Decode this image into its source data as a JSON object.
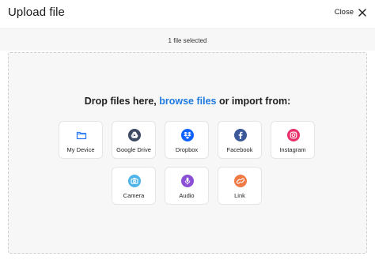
{
  "header": {
    "title": "Upload file",
    "close_label": "Close"
  },
  "subbar": {
    "status": "1 file selected"
  },
  "dropzone": {
    "prompt_start": "Drop files here, ",
    "prompt_link": "browse files",
    "prompt_end": " or import from:"
  },
  "sources": [
    {
      "label": "My Device",
      "icon": "folder-icon",
      "color": "#2f7bf5"
    },
    {
      "label": "Google Drive",
      "icon": "google-drive-icon",
      "color": "#3c4a63"
    },
    {
      "label": "Dropbox",
      "icon": "dropbox-icon",
      "color": "#0d61ff"
    },
    {
      "label": "Facebook",
      "icon": "facebook-icon",
      "color": "#3b5998"
    },
    {
      "label": "Instagram",
      "icon": "instagram-icon",
      "color": "#e8316b"
    },
    {
      "label": "Camera",
      "icon": "camera-icon",
      "color": "#4fb4e8"
    },
    {
      "label": "Audio",
      "icon": "microphone-icon",
      "color": "#8b4fd6"
    },
    {
      "label": "Link",
      "icon": "link-icon",
      "color": "#f07a46"
    }
  ]
}
